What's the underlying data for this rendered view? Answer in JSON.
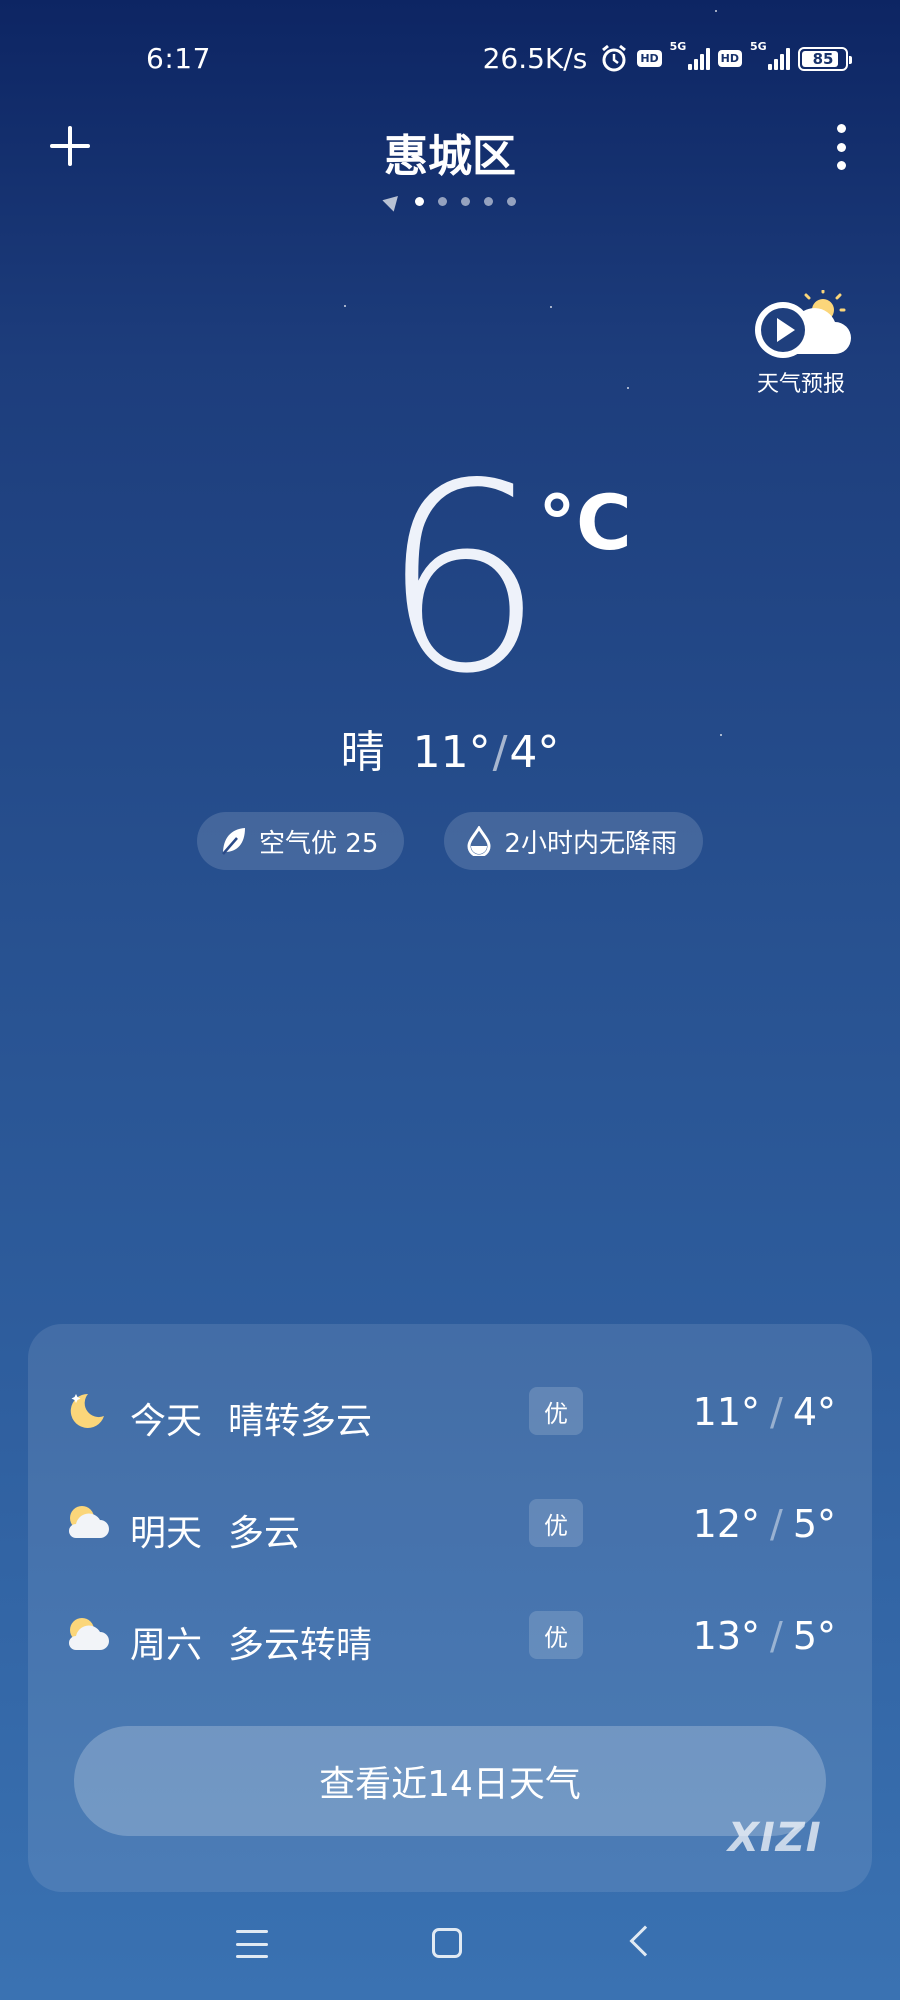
{
  "status_bar": {
    "time": "6:17",
    "net_speed": "26.5K/s",
    "hd_label": "HD",
    "net_5g": "5G",
    "battery": "85",
    "battery_fraction": 0.85
  },
  "header": {
    "city": "惠城区",
    "page_count": 5,
    "active_page": 0
  },
  "forecast_video": {
    "label": "天气预报"
  },
  "current": {
    "temp": "6",
    "unit": "°C",
    "condition": "晴",
    "high": "11°",
    "low": "4°"
  },
  "chips": {
    "air": "空气优 25",
    "rain": "2小时内无降雨"
  },
  "forecast": [
    {
      "day": "今天",
      "condition": "晴转多云",
      "aqi": "优",
      "high": "11°",
      "low": "4°",
      "icon": "moon-icon"
    },
    {
      "day": "明天",
      "condition": "多云",
      "aqi": "优",
      "high": "12°",
      "low": "5°",
      "icon": "partly-cloudy-icon"
    },
    {
      "day": "周六",
      "condition": "多云转晴",
      "aqi": "优",
      "high": "13°",
      "low": "5°",
      "icon": "partly-cloudy-icon"
    }
  ],
  "button_14": "查看近14日天气",
  "watermark": "XIZI",
  "colors": {
    "accent": "#fbd67a",
    "bg_top": "#0d2563",
    "bg_bottom": "#3a72b2"
  }
}
